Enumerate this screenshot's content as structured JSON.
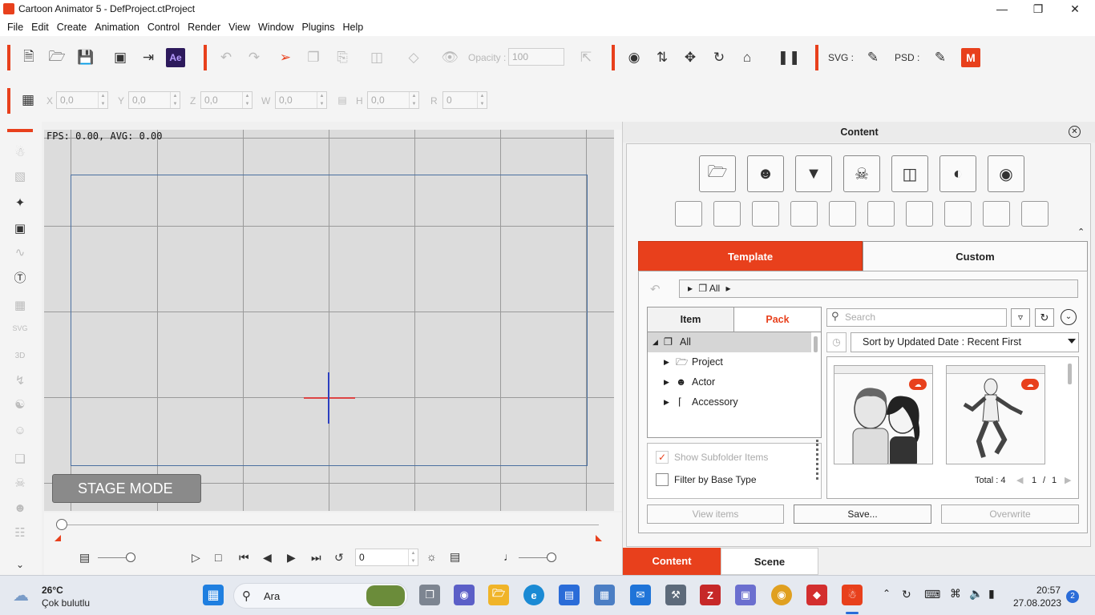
{
  "window": {
    "title": "Cartoon Animator 5 - DefProject.ctProject"
  },
  "menu": [
    "File",
    "Edit",
    "Create",
    "Animation",
    "Control",
    "Render",
    "View",
    "Window",
    "Plugins",
    "Help"
  ],
  "toolbar": {
    "opacity_label": "Opacity :",
    "opacity_value": "100",
    "svg_label": "SVG :",
    "psd_label": "PSD :",
    "ae_label": "Ae"
  },
  "transform": {
    "x_label": "X",
    "x_value": "0,0",
    "y_label": "Y",
    "y_value": "0,0",
    "z_label": "Z",
    "z_value": "0,0",
    "w_label": "W",
    "w_value": "0,0",
    "h_label": "H",
    "h_value": "0,0",
    "r_label": "R",
    "r_value": "0"
  },
  "stage": {
    "fps_text": "FPS: 0.00, AVG: 0.00",
    "mode_label": "STAGE MODE"
  },
  "timeline": {
    "frame_value": "0"
  },
  "content": {
    "panel_title": "Content",
    "tab_template": "Template",
    "tab_custom": "Custom",
    "breadcrumb": "All",
    "tab_item": "Item",
    "tab_pack": "Pack",
    "tree": [
      {
        "label": "All",
        "level": 0,
        "selected": true
      },
      {
        "label": "Project",
        "level": 1,
        "selected": false
      },
      {
        "label": "Actor",
        "level": 1,
        "selected": false
      },
      {
        "label": "Accessory",
        "level": 1,
        "selected": false
      }
    ],
    "show_subfolder_label": "Show Subfolder Items",
    "filter_base_label": "Filter by Base Type",
    "search_placeholder": "Search",
    "sort_value": "Sort by Updated Date : Recent First",
    "total_label": "Total : 4",
    "page_current": "1",
    "page_sep": "/",
    "page_total": "1",
    "btn_view_items": "View items",
    "btn_save": "Save...",
    "btn_overwrite": "Overwrite",
    "bottom_tab_content": "Content",
    "bottom_tab_scene": "Scene"
  },
  "taskbar": {
    "weather_temp": "26°C",
    "weather_desc": "Çok bulutlu",
    "search_label": "Ara",
    "time": "20:57",
    "date": "27.08.2023",
    "notification_count": "2"
  },
  "colors": {
    "accent": "#e8401c",
    "frame": "#4a6fa0"
  }
}
